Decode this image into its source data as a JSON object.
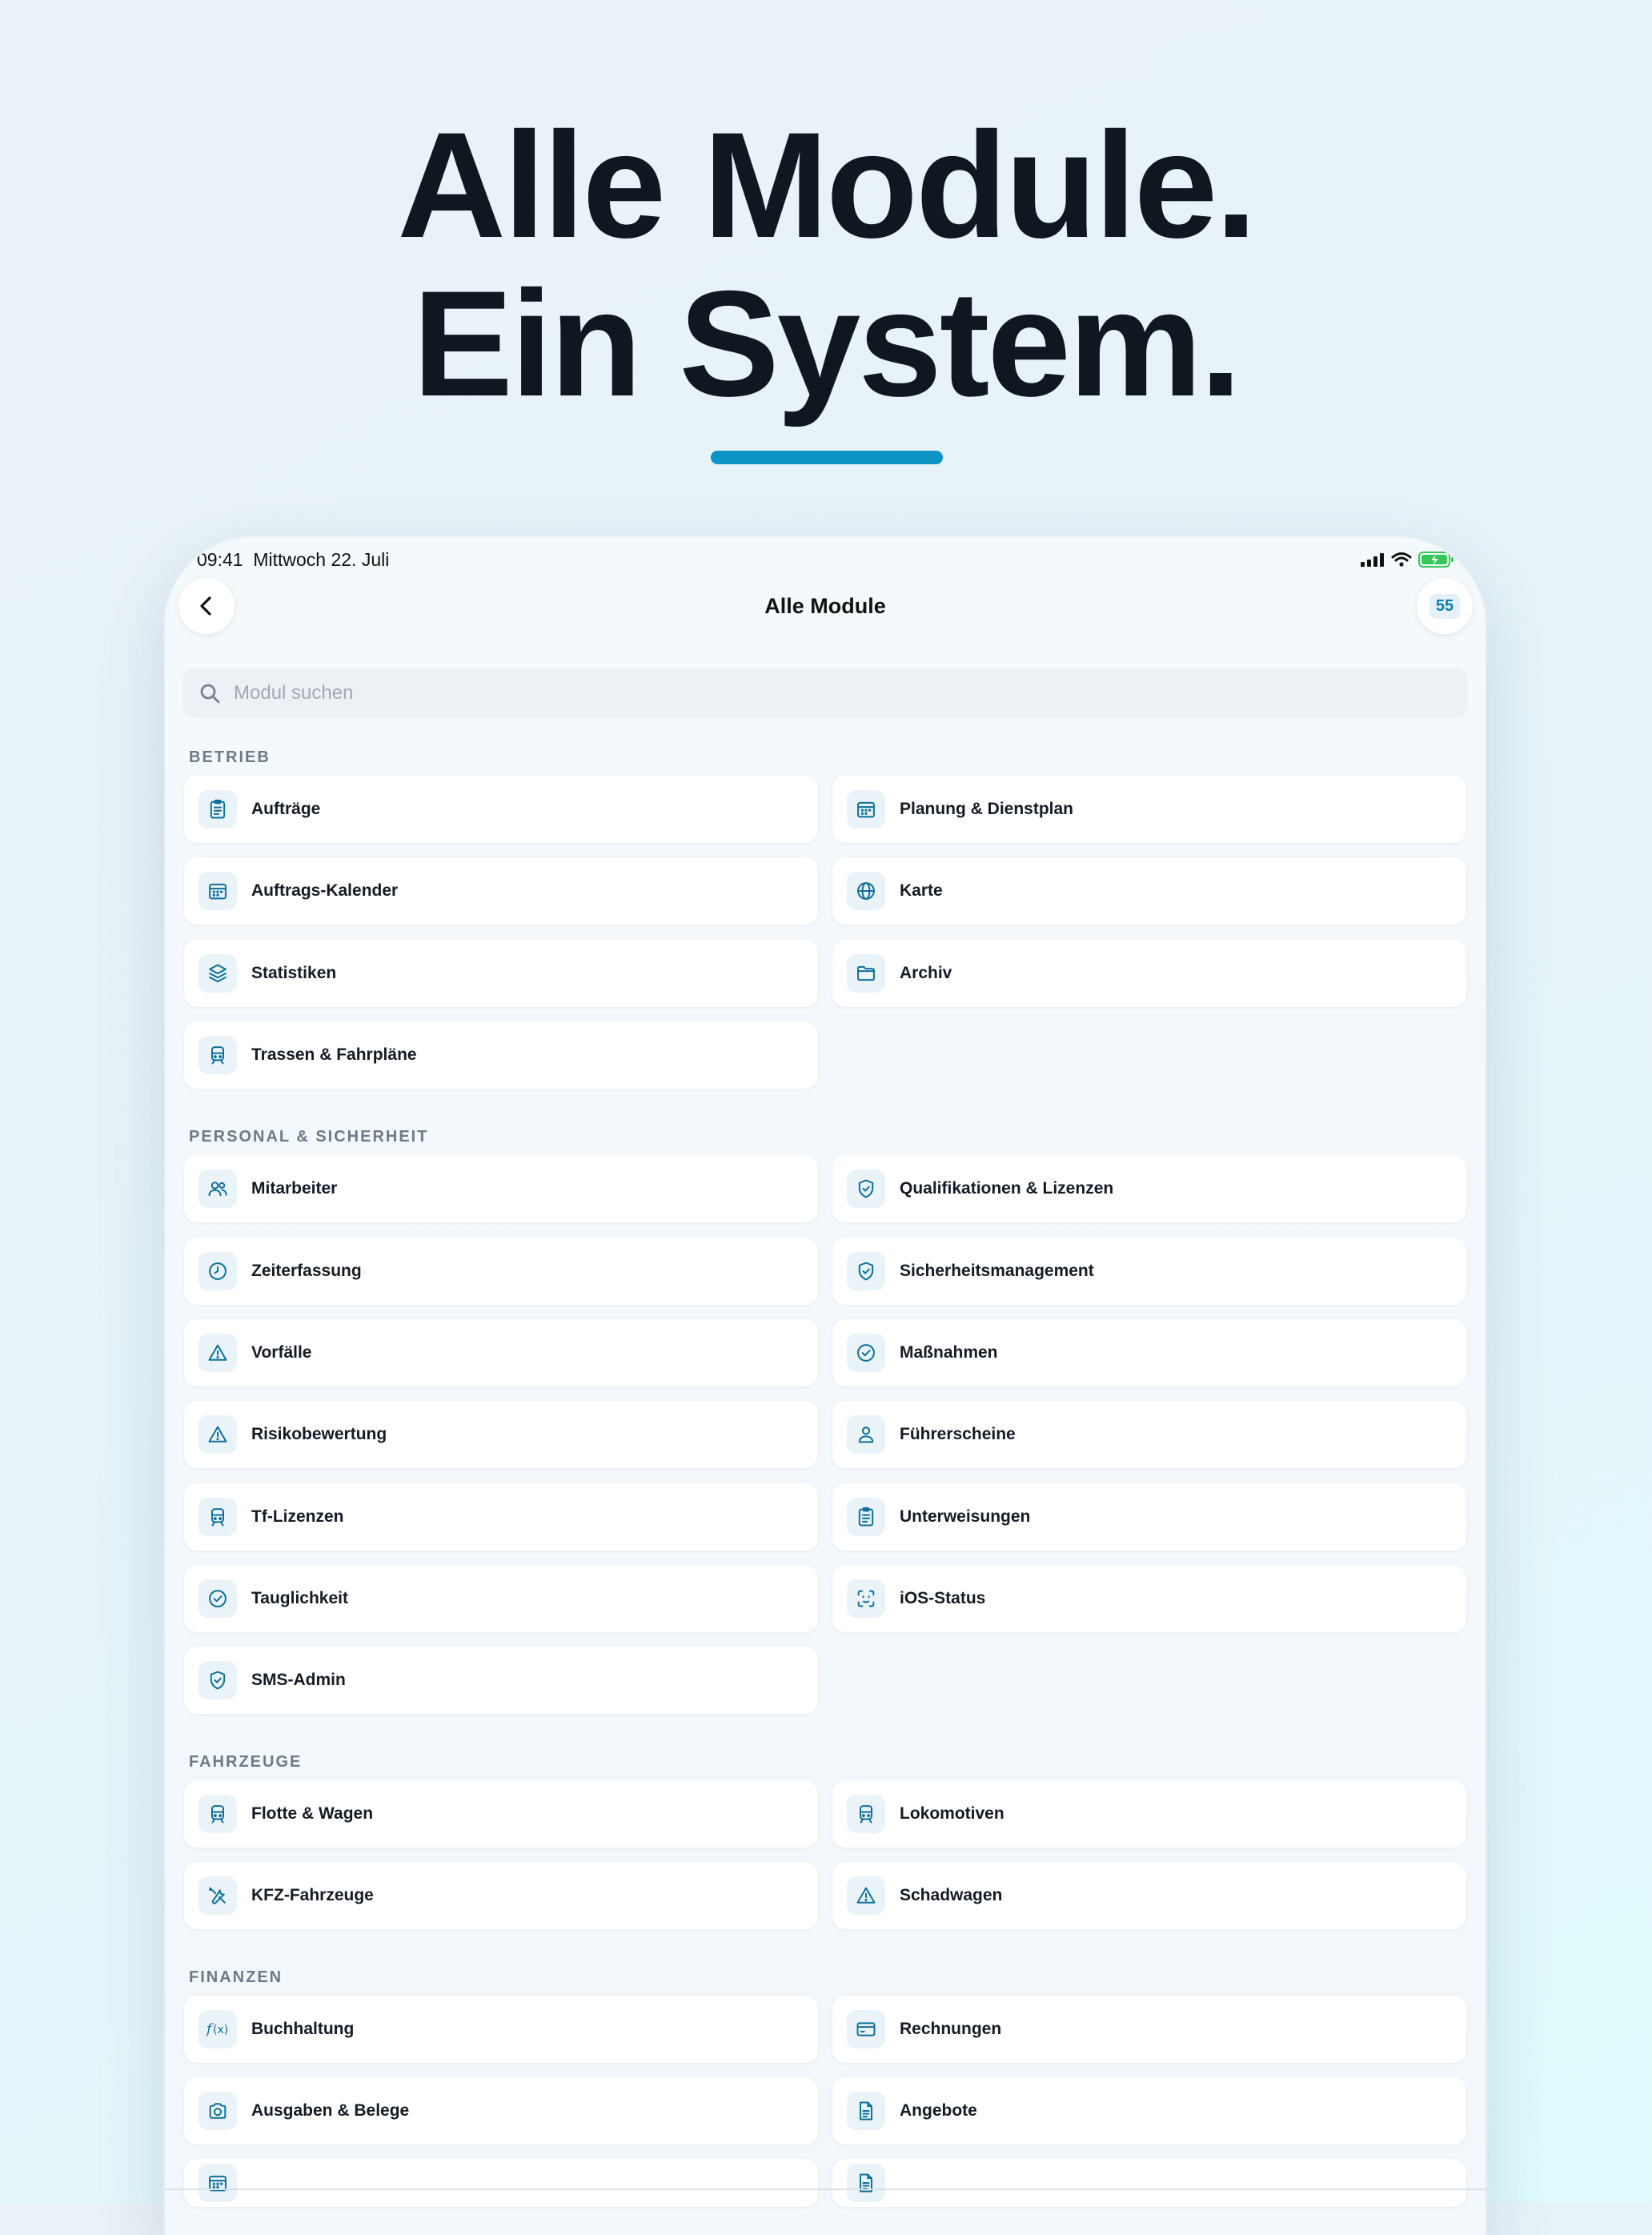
{
  "headline": {
    "line1": "Alle Module.",
    "line2": "Ein System."
  },
  "colors": {
    "accent": "#0d93c6",
    "icon": "#0e6f98",
    "icon_bg": "#eaf3f8"
  },
  "status_bar": {
    "time": "09:41",
    "date": "Mittwoch 22. Juli"
  },
  "nav": {
    "title": "Alle Module",
    "count": "55"
  },
  "search": {
    "placeholder": "Modul suchen"
  },
  "sections": [
    {
      "title": "BETRIEB",
      "items": [
        {
          "label": "Aufträge",
          "icon": "clipboard-icon"
        },
        {
          "label": "Planung & Dienstplan",
          "icon": "calendar-icon"
        },
        {
          "label": "Auftrags-Kalender",
          "icon": "calendar-icon"
        },
        {
          "label": "Karte",
          "icon": "globe-icon"
        },
        {
          "label": "Statistiken",
          "icon": "layers-icon"
        },
        {
          "label": "Archiv",
          "icon": "folder-icon"
        },
        {
          "label": "Trassen & Fahrpläne",
          "icon": "train-icon"
        }
      ]
    },
    {
      "title": "PERSONAL & SICHERHEIT",
      "items": [
        {
          "label": "Mitarbeiter",
          "icon": "users-icon"
        },
        {
          "label": "Qualifikationen & Lizenzen",
          "icon": "shield-check-icon"
        },
        {
          "label": "Zeiterfassung",
          "icon": "clock-icon"
        },
        {
          "label": "Sicherheitsmanagement",
          "icon": "shield-check-icon"
        },
        {
          "label": "Vorfälle",
          "icon": "warning-icon"
        },
        {
          "label": "Maßnahmen",
          "icon": "check-circle-icon"
        },
        {
          "label": "Risikobewertung",
          "icon": "warning-icon"
        },
        {
          "label": "Führerscheine",
          "icon": "person-icon"
        },
        {
          "label": "Tf-Lizenzen",
          "icon": "train-icon"
        },
        {
          "label": "Unterweisungen",
          "icon": "clipboard-icon"
        },
        {
          "label": "Tauglichkeit",
          "icon": "check-circle-icon"
        },
        {
          "label": "iOS-Status",
          "icon": "face-scan-icon"
        },
        {
          "label": "SMS-Admin",
          "icon": "shield-check-icon"
        }
      ]
    },
    {
      "title": "FAHRZEUGE",
      "items": [
        {
          "label": "Flotte & Wagen",
          "icon": "train-icon"
        },
        {
          "label": "Lokomotiven",
          "icon": "train-icon"
        },
        {
          "label": "KFZ-Fahrzeuge",
          "icon": "tools-icon"
        },
        {
          "label": "Schadwagen",
          "icon": "warning-icon"
        }
      ]
    },
    {
      "title": "FINANZEN",
      "items": [
        {
          "label": "Buchhaltung",
          "icon": "function-icon"
        },
        {
          "label": "Rechnungen",
          "icon": "credit-card-icon"
        },
        {
          "label": "Ausgaben & Belege",
          "icon": "camera-icon"
        },
        {
          "label": "Angebote",
          "icon": "document-icon"
        }
      ]
    }
  ]
}
